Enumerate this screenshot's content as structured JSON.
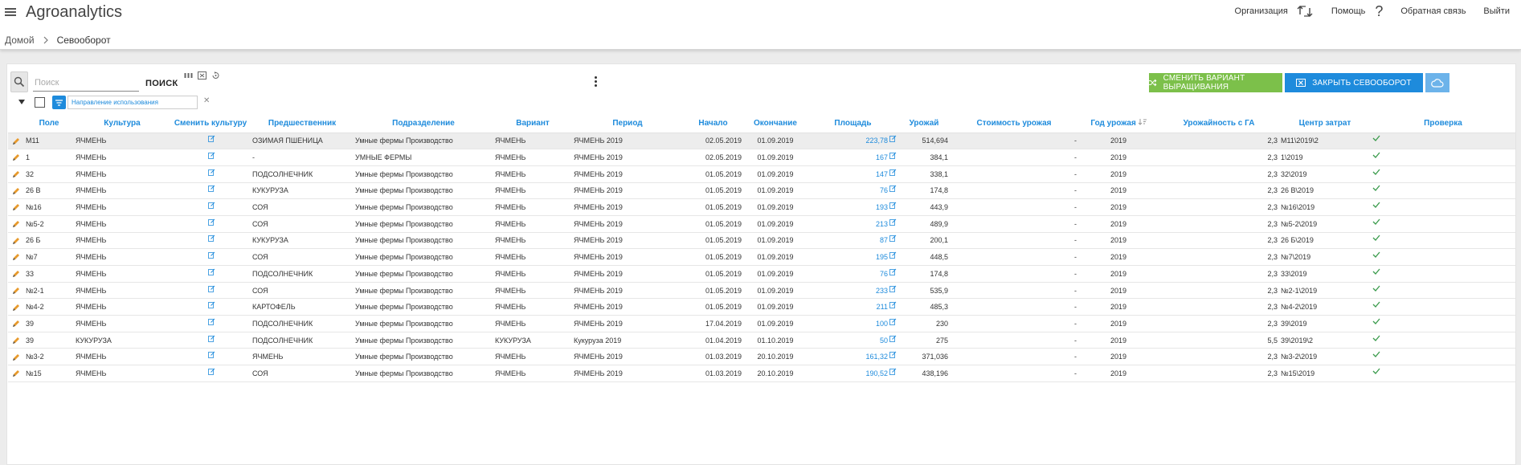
{
  "header": {
    "app_title": "Agroanalytics",
    "organization_label": "Организация",
    "help_label": "Помощь",
    "feedback_label": "Обратная связь",
    "logout_label": "Выйти"
  },
  "breadcrumb": {
    "home": "Домой",
    "current": "Севооборот"
  },
  "toolbar": {
    "search_placeholder": "Поиск",
    "search_label": "ПОИСК",
    "change_variant_label": "СМЕНИТЬ ВАРИАНТ ВЫРАЩИВАНИЯ",
    "close_rotation_label": "ЗАКРЫТЬ СЕВООБОРОТ",
    "filter_label": "Направление использования"
  },
  "colors": {
    "accent": "#1e8bdc",
    "green_button": "#7cc04a",
    "cloud_button": "#6cb3ea",
    "pencil": "#e89a2c",
    "check": "#3a9b4c"
  },
  "table": {
    "columns": [
      "Поле",
      "Культура",
      "Сменить культуру",
      "Предшественник",
      "Подразделение",
      "Вариант",
      "Период",
      "Начало",
      "Окончание",
      "Площадь",
      "Урожай",
      "Стоимость урожая",
      "Год урожая",
      "Урожайность с ГА",
      "Центр затрат",
      "Проверка"
    ],
    "rows": [
      {
        "field": "M11",
        "crop": "ЯЧМЕНЬ",
        "predecessor": "ОЗИМАЯ ПШЕНИЦА",
        "division": "Умные фермы Производство",
        "variant": "ЯЧМЕНЬ",
        "period": "ЯЧМЕНЬ 2019",
        "start": "02.05.2019",
        "end": "01.09.2019",
        "area": "223,78",
        "harvest": "514,694",
        "cost": "-",
        "year": "2019",
        "yield": "2,3",
        "cost_center": "M11\\2019\\2"
      },
      {
        "field": "1",
        "crop": "ЯЧМЕНЬ",
        "predecessor": "-",
        "division": "УМНЫЕ ФЕРМЫ",
        "variant": "ЯЧМЕНЬ",
        "period": "ЯЧМЕНЬ 2019",
        "start": "02.05.2019",
        "end": "01.09.2019",
        "area": "167",
        "harvest": "384,1",
        "cost": "-",
        "year": "2019",
        "yield": "2,3",
        "cost_center": "1\\2019"
      },
      {
        "field": "32",
        "crop": "ЯЧМЕНЬ",
        "predecessor": "ПОДСОЛНЕЧНИК",
        "division": "Умные фермы Производство",
        "variant": "ЯЧМЕНЬ",
        "period": "ЯЧМЕНЬ 2019",
        "start": "01.05.2019",
        "end": "01.09.2019",
        "area": "147",
        "harvest": "338,1",
        "cost": "-",
        "year": "2019",
        "yield": "2,3",
        "cost_center": "32\\2019"
      },
      {
        "field": "26 В",
        "crop": "ЯЧМЕНЬ",
        "predecessor": "КУКУРУЗА",
        "division": "Умные фермы Производство",
        "variant": "ЯЧМЕНЬ",
        "period": "ЯЧМЕНЬ 2019",
        "start": "01.05.2019",
        "end": "01.09.2019",
        "area": "76",
        "harvest": "174,8",
        "cost": "-",
        "year": "2019",
        "yield": "2,3",
        "cost_center": "26 В\\2019"
      },
      {
        "field": "№16",
        "crop": "ЯЧМЕНЬ",
        "predecessor": "СОЯ",
        "division": "Умные фермы Производство",
        "variant": "ЯЧМЕНЬ",
        "period": "ЯЧМЕНЬ 2019",
        "start": "01.05.2019",
        "end": "01.09.2019",
        "area": "193",
        "harvest": "443,9",
        "cost": "-",
        "year": "2019",
        "yield": "2,3",
        "cost_center": "№16\\2019"
      },
      {
        "field": "№5-2",
        "crop": "ЯЧМЕНЬ",
        "predecessor": "СОЯ",
        "division": "Умные фермы Производство",
        "variant": "ЯЧМЕНЬ",
        "period": "ЯЧМЕНЬ 2019",
        "start": "01.05.2019",
        "end": "01.09.2019",
        "area": "213",
        "harvest": "489,9",
        "cost": "-",
        "year": "2019",
        "yield": "2,3",
        "cost_center": "№5-2\\2019"
      },
      {
        "field": "26 Б",
        "crop": "ЯЧМЕНЬ",
        "predecessor": "КУКУРУЗА",
        "division": "Умные фермы Производство",
        "variant": "ЯЧМЕНЬ",
        "period": "ЯЧМЕНЬ 2019",
        "start": "01.05.2019",
        "end": "01.09.2019",
        "area": "87",
        "harvest": "200,1",
        "cost": "-",
        "year": "2019",
        "yield": "2,3",
        "cost_center": "26 Б\\2019"
      },
      {
        "field": "№7",
        "crop": "ЯЧМЕНЬ",
        "predecessor": "СОЯ",
        "division": "Умные фермы Производство",
        "variant": "ЯЧМЕНЬ",
        "period": "ЯЧМЕНЬ 2019",
        "start": "01.05.2019",
        "end": "01.09.2019",
        "area": "195",
        "harvest": "448,5",
        "cost": "-",
        "year": "2019",
        "yield": "2,3",
        "cost_center": "№7\\2019"
      },
      {
        "field": "33",
        "crop": "ЯЧМЕНЬ",
        "predecessor": "ПОДСОЛНЕЧНИК",
        "division": "Умные фермы Производство",
        "variant": "ЯЧМЕНЬ",
        "period": "ЯЧМЕНЬ 2019",
        "start": "01.05.2019",
        "end": "01.09.2019",
        "area": "76",
        "harvest": "174,8",
        "cost": "-",
        "year": "2019",
        "yield": "2,3",
        "cost_center": "33\\2019"
      },
      {
        "field": "№2-1",
        "crop": "ЯЧМЕНЬ",
        "predecessor": "СОЯ",
        "division": "Умные фермы Производство",
        "variant": "ЯЧМЕНЬ",
        "period": "ЯЧМЕНЬ 2019",
        "start": "01.05.2019",
        "end": "01.09.2019",
        "area": "233",
        "harvest": "535,9",
        "cost": "-",
        "year": "2019",
        "yield": "2,3",
        "cost_center": "№2-1\\2019"
      },
      {
        "field": "№4-2",
        "crop": "ЯЧМЕНЬ",
        "predecessor": "КАРТОФЕЛЬ",
        "division": "Умные фермы Производство",
        "variant": "ЯЧМЕНЬ",
        "period": "ЯЧМЕНЬ 2019",
        "start": "01.05.2019",
        "end": "01.09.2019",
        "area": "211",
        "harvest": "485,3",
        "cost": "-",
        "year": "2019",
        "yield": "2,3",
        "cost_center": "№4-2\\2019"
      },
      {
        "field": "39",
        "crop": "ЯЧМЕНЬ",
        "predecessor": "ПОДСОЛНЕЧНИК",
        "division": "Умные фермы Производство",
        "variant": "ЯЧМЕНЬ",
        "period": "ЯЧМЕНЬ 2019",
        "start": "17.04.2019",
        "end": "01.09.2019",
        "area": "100",
        "harvest": "230",
        "cost": "-",
        "year": "2019",
        "yield": "2,3",
        "cost_center": "39\\2019"
      },
      {
        "field": "39",
        "crop": "КУКУРУЗА",
        "predecessor": "ПОДСОЛНЕЧНИК",
        "division": "Умные фермы Производство",
        "variant": "КУКУРУЗА",
        "period": "Кукуруза 2019",
        "start": "01.04.2019",
        "end": "01.10.2019",
        "area": "50",
        "harvest": "275",
        "cost": "-",
        "year": "2019",
        "yield": "5,5",
        "cost_center": "39\\2019\\2"
      },
      {
        "field": "№3-2",
        "crop": "ЯЧМЕНЬ",
        "predecessor": "ЯЧМЕНЬ",
        "division": "Умные фермы Производство",
        "variant": "ЯЧМЕНЬ",
        "period": "ЯЧМЕНЬ 2019",
        "start": "01.03.2019",
        "end": "20.10.2019",
        "area": "161,32",
        "harvest": "371,036",
        "cost": "-",
        "year": "2019",
        "yield": "2,3",
        "cost_center": "№3-2\\2019"
      },
      {
        "field": "№15",
        "crop": "ЯЧМЕНЬ",
        "predecessor": "СОЯ",
        "division": "Умные фермы Производство",
        "variant": "ЯЧМЕНЬ",
        "period": "ЯЧМЕНЬ 2019",
        "start": "01.03.2019",
        "end": "20.10.2019",
        "area": "190,52",
        "harvest": "438,196",
        "cost": "-",
        "year": "2019",
        "yield": "2,3",
        "cost_center": "№15\\2019"
      }
    ]
  }
}
